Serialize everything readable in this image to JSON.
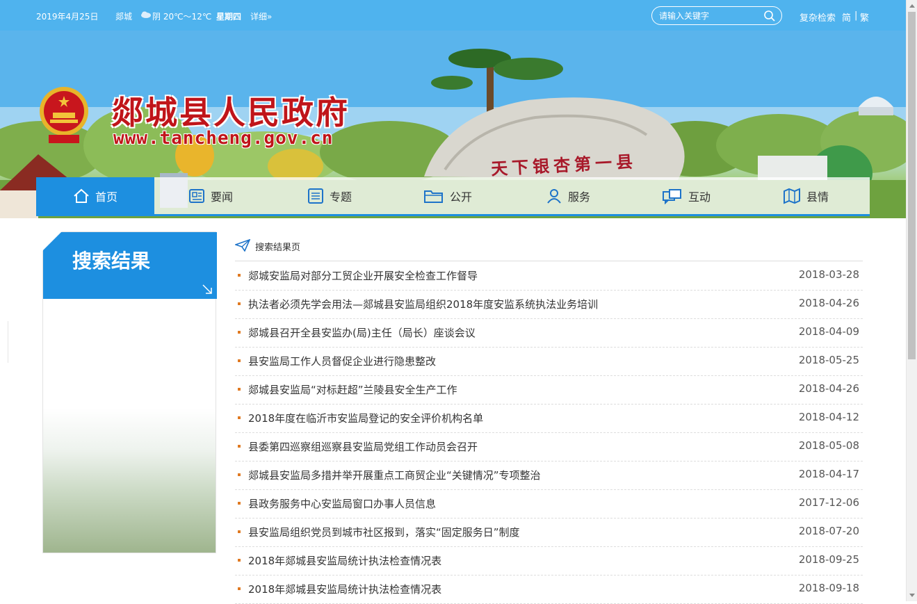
{
  "topbar": {
    "date": "2019年4月25日",
    "city": "郯城",
    "weather": "阴 20℃～12℃",
    "weekday": "星期四",
    "detail_link": "详细»",
    "search_placeholder": "请输入关键字",
    "advanced_search": "复杂检索",
    "simplified": "简",
    "separator": "|",
    "traditional": "繁"
  },
  "banner": {
    "site_title": "郯城县人民政府",
    "site_url": "www.tancheng.gov.cn",
    "rock_inscription": "天下银杏第一县"
  },
  "nav": [
    {
      "label": "首页",
      "icon": "home-icon"
    },
    {
      "label": "要闻",
      "icon": "news-icon"
    },
    {
      "label": "专题",
      "icon": "list-icon"
    },
    {
      "label": "公开",
      "icon": "folder-icon"
    },
    {
      "label": "服务",
      "icon": "user-icon"
    },
    {
      "label": "互动",
      "icon": "chat-icon"
    },
    {
      "label": "县情",
      "icon": "map-icon"
    }
  ],
  "sidebar": {
    "title": "搜索结果"
  },
  "results": {
    "breadcrumb": "搜索结果页",
    "items": [
      {
        "title": "郯城安监局对部分工贸企业开展安全检查工作督导",
        "date": "2018-03-28"
      },
      {
        "title": "执法者必须先学会用法—郯城县安监局组织2018年度安监系统执法业务培训",
        "date": "2018-04-26"
      },
      {
        "title": "郯城县召开全县安监办(局)主任（局长）座谈会议",
        "date": "2018-04-09"
      },
      {
        "title": "县安监局工作人员督促企业进行隐患整改",
        "date": "2018-05-25"
      },
      {
        "title": "郯城县安监局“对标赶超”兰陵县安全生产工作",
        "date": "2018-04-26"
      },
      {
        "title": "2018年度在临沂市安监局登记的安全评价机构名单",
        "date": "2018-04-12"
      },
      {
        "title": "县委第四巡察组巡察县安监局党组工作动员会召开",
        "date": "2018-05-08"
      },
      {
        "title": "郯城县安监局多措并举开展重点工商贸企业“关键情况”专项整治",
        "date": "2018-04-17"
      },
      {
        "title": "县政务服务中心安监局窗口办事人员信息",
        "date": "2017-12-06"
      },
      {
        "title": "县安监局组织党员到城市社区报到，落实“固定服务日”制度",
        "date": "2018-07-20"
      },
      {
        "title": "2018年郯城县安监局统计执法检查情况表",
        "date": "2018-09-25"
      },
      {
        "title": "2018年郯城县安监局统计执法检查情况表",
        "date": "2018-09-18"
      }
    ]
  },
  "colors": {
    "topbar": "#4fb3ee",
    "accent": "#1d8fe0",
    "title_red": "#c0151a",
    "bullet": "#e07a22"
  }
}
